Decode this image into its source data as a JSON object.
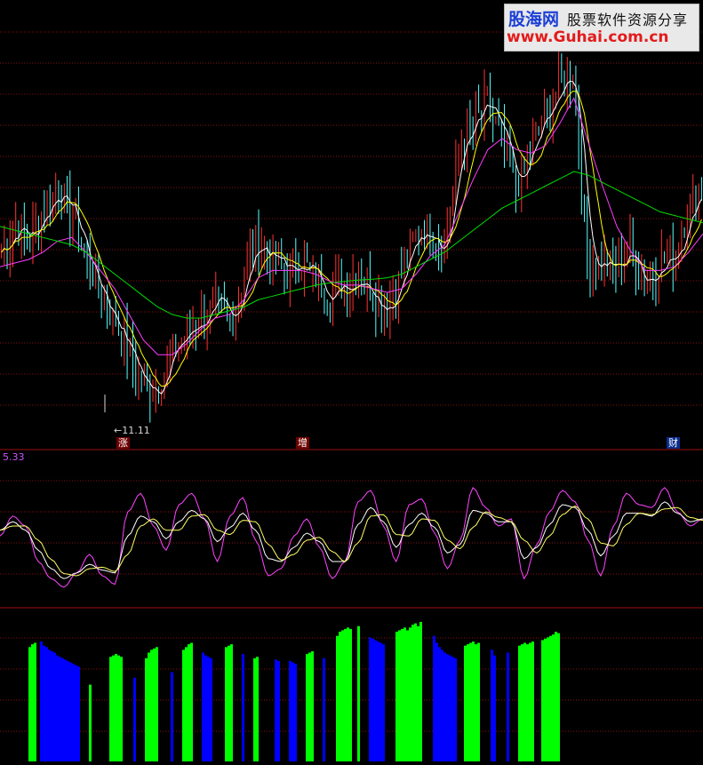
{
  "watermark": {
    "brand": "股海网",
    "tagline": "股票软件资源分享",
    "url": "www.Guhai.com.cn"
  },
  "labels": {
    "low_price": "11.11",
    "oscillator_value": "5.33",
    "events": [
      "涨",
      "增",
      "财"
    ]
  },
  "colors": {
    "background": "#000000",
    "grid": "#8a1010",
    "panel_divider": "#a01010",
    "candle_up": "#ff3232",
    "candle_down": "#54ffff",
    "ma_short": "#ffffff",
    "ma_mid": "#ffff00",
    "ma_long_purple": "#ff3cff",
    "ma_long_green": "#00dd00",
    "osc_fast": "#ff44ff",
    "osc_slow": "#ffffff",
    "osc_signal": "#ffff66",
    "bar_green": "#00ff00",
    "bar_blue": "#0000ff"
  },
  "chart_data": [
    {
      "type": "line",
      "panel": "price",
      "series": [
        {
          "key": "close",
          "values": [
            13.2,
            13.6,
            13.35,
            13.8,
            14.05,
            13.7,
            13.1,
            12.6,
            12.25,
            11.8,
            11.35,
            11.4,
            11.85,
            12.1,
            12.3,
            12.45,
            12.25,
            12.9,
            13.35,
            13.1,
            12.95,
            13.05,
            12.85,
            12.65,
            12.75,
            12.9,
            12.65,
            12.45,
            12.9,
            13.4,
            13.55,
            13.25,
            14.6,
            14.9,
            15.2,
            14.75,
            14.05,
            14.55,
            15.05,
            15.4,
            15.7,
            13.15,
            13.05,
            12.95,
            13.25,
            12.8,
            13.05,
            13.1,
            13.75,
            14.05
          ]
        },
        {
          "key": "ma_purple",
          "values": [
            13.0,
            13.05,
            13.1,
            13.2,
            13.35,
            13.4,
            13.2,
            12.95,
            12.7,
            12.35,
            12.0,
            11.8,
            11.8,
            11.95,
            12.15,
            12.3,
            12.35,
            12.55,
            12.85,
            12.95,
            12.95,
            12.95,
            12.9,
            12.8,
            12.75,
            12.75,
            12.7,
            12.65,
            12.7,
            12.9,
            13.15,
            13.3,
            13.75,
            14.2,
            14.6,
            14.75,
            14.6,
            14.55,
            14.65,
            14.95,
            15.3,
            14.7,
            14.1,
            13.55,
            13.2,
            12.95,
            12.95,
            13.0,
            13.2,
            13.45
          ]
        },
        {
          "key": "ma_green",
          "values": [
            13.55,
            13.5,
            13.45,
            13.4,
            13.35,
            13.3,
            13.2,
            13.05,
            12.9,
            12.75,
            12.6,
            12.45,
            12.35,
            12.3,
            12.3,
            12.35,
            12.4,
            12.45,
            12.55,
            12.6,
            12.65,
            12.7,
            12.75,
            12.78,
            12.8,
            12.82,
            12.83,
            12.85,
            12.9,
            13.0,
            13.1,
            13.2,
            13.35,
            13.5,
            13.65,
            13.8,
            13.9,
            14.0,
            14.1,
            14.2,
            14.3,
            14.25,
            14.15,
            14.05,
            13.95,
            13.85,
            13.75,
            13.7,
            13.65,
            13.6
          ]
        }
      ],
      "low_marker": 11.11,
      "ylim": [
        10.7,
        16.3
      ]
    },
    {
      "type": "line",
      "panel": "oscillator",
      "series": [
        {
          "key": "fast",
          "values": [
            48,
            62,
            55,
            30,
            18,
            12,
            22,
            35,
            20,
            14,
            65,
            78,
            55,
            38,
            70,
            78,
            60,
            30,
            62,
            75,
            45,
            20,
            25,
            48,
            60,
            40,
            18,
            30,
            72,
            80,
            55,
            30,
            70,
            74,
            50,
            25,
            45,
            82,
            68,
            55,
            60,
            18,
            42,
            65,
            80,
            72,
            45,
            20,
            55,
            78,
            70,
            68,
            82,
            65,
            55,
            60
          ]
        },
        {
          "key": "slow",
          "values": [
            52,
            58,
            52,
            38,
            25,
            18,
            22,
            28,
            24,
            22,
            48,
            62,
            58,
            46,
            58,
            66,
            60,
            44,
            54,
            64,
            52,
            32,
            30,
            40,
            50,
            44,
            30,
            30,
            56,
            68,
            58,
            40,
            56,
            64,
            54,
            36,
            42,
            66,
            64,
            58,
            58,
            32,
            40,
            56,
            70,
            68,
            52,
            34,
            48,
            64,
            64,
            62,
            72,
            64,
            58,
            60
          ]
        }
      ],
      "ylim": [
        0,
        100
      ]
    },
    {
      "type": "bar",
      "panel": "histogram",
      "bars": [
        {
          "color": "green",
          "values": [
            0.82,
            0.84,
            0.85
          ]
        },
        {
          "color": "blue",
          "values": [
            0.86,
            0.83,
            0.82,
            0.8,
            0.79,
            0.78,
            0.76,
            0.75,
            0.74,
            0.73,
            0.72,
            0.71,
            0.7,
            0.69,
            0.68
          ]
        },
        {
          "color": "green",
          "values": [
            0.55
          ]
        },
        {
          "color": "green",
          "values": [
            0.75,
            0.76,
            0.77,
            0.76,
            0.75
          ]
        },
        {
          "color": "blue",
          "values": [
            0.6
          ]
        },
        {
          "color": "green",
          "values": [
            0.74,
            0.78,
            0.8,
            0.81,
            0.82
          ]
        },
        {
          "color": "blue",
          "values": [
            0.64
          ]
        },
        {
          "color": "green",
          "values": [
            0.8,
            0.82,
            0.84,
            0.85
          ]
        },
        {
          "color": "blue",
          "values": [
            0.78,
            0.76,
            0.75,
            0.74
          ]
        },
        {
          "color": "green",
          "values": [
            0.82,
            0.83,
            0.84
          ]
        },
        {
          "color": "blue",
          "values": [
            0.77
          ]
        },
        {
          "color": "green",
          "values": [
            0.74,
            0.75
          ]
        },
        {
          "color": "blue",
          "values": [
            0.73,
            0.72
          ]
        },
        {
          "color": "blue",
          "values": [
            0.72,
            0.71,
            0.7
          ]
        },
        {
          "color": "green",
          "values": [
            0.77,
            0.78,
            0.79
          ]
        },
        {
          "color": "blue",
          "values": [
            0.74
          ]
        },
        {
          "color": "green",
          "values": [
            0.9,
            0.93,
            0.94,
            0.95,
            0.96,
            0.95
          ]
        },
        {
          "color": "green",
          "values": [
            0.97
          ]
        },
        {
          "color": "blue",
          "values": [
            0.89,
            0.88,
            0.87,
            0.86,
            0.85,
            0.84
          ]
        },
        {
          "color": "green",
          "values": [
            0.93,
            0.94,
            0.95,
            0.96,
            0.94,
            0.96,
            0.98,
            0.99,
            0.97,
            1.0
          ]
        },
        {
          "color": "blue",
          "values": [
            0.9,
            0.85,
            0.82,
            0.8,
            0.78,
            0.77,
            0.76,
            0.75,
            0.74
          ]
        },
        {
          "color": "green",
          "values": [
            0.83,
            0.84,
            0.85,
            0.86,
            0.84,
            0.85
          ]
        },
        {
          "color": "blue",
          "values": [
            0.8,
            0.76
          ]
        },
        {
          "color": "blue",
          "values": [
            0.78
          ]
        },
        {
          "color": "green",
          "values": [
            0.83,
            0.84,
            0.85,
            0.84,
            0.85,
            0.86
          ]
        },
        {
          "color": "green",
          "values": [
            0.87,
            0.88,
            0.89,
            0.9,
            0.91,
            0.93,
            0.92
          ]
        }
      ],
      "ylim": [
        0,
        1
      ]
    }
  ]
}
